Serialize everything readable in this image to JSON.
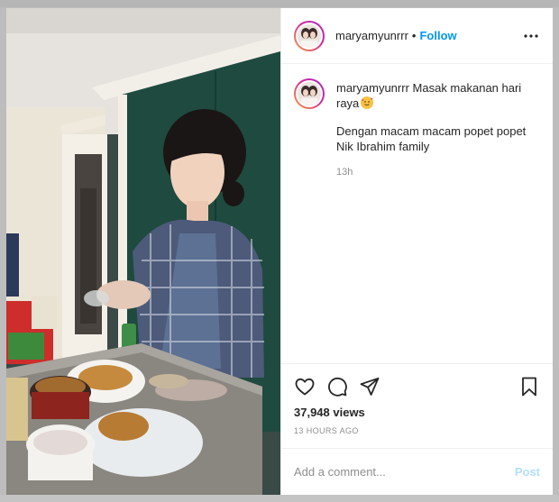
{
  "post": {
    "username": "maryamyunrrr",
    "follow_label": "Follow",
    "separator": "•",
    "caption_line1": "Masak makanan hari raya",
    "caption_line2": "Dengan macam macam popet popet Nik Ibrahim family",
    "caption_time": "13h",
    "views": "37,948 views",
    "time_ago": "13 HOURS AGO"
  },
  "comment": {
    "placeholder": "Add a comment...",
    "post_label": "Post"
  },
  "icons": {
    "more": "more-options-icon",
    "like": "heart-icon",
    "comment": "comment-bubble-icon",
    "share": "paper-plane-icon",
    "save": "bookmark-icon",
    "emoji": "smiling-face-with-hearts-emoji"
  },
  "colors": {
    "accent": "#0095f6",
    "post_disabled": "#b2dffc",
    "text": "#262626",
    "muted": "#8e8e8e",
    "border": "#efefef"
  }
}
